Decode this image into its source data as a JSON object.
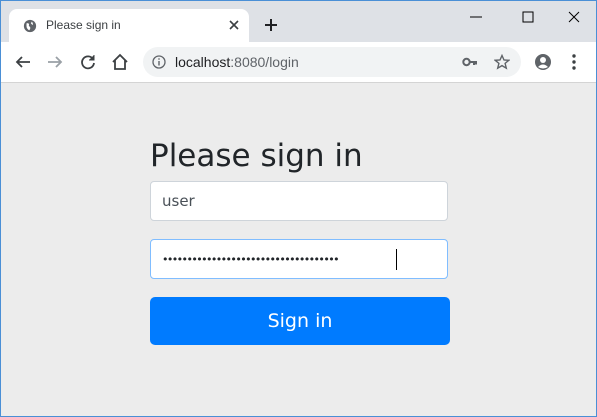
{
  "tab": {
    "title": "Please sign in"
  },
  "toolbar": {
    "url_host": "localhost",
    "url_rest": ":8080/login"
  },
  "form": {
    "heading": "Please sign in",
    "username_value": "user",
    "password_value": "••••••••••••••••••••••••••••••••••••",
    "submit_label": "Sign in"
  },
  "colors": {
    "primary_button": "#007bff",
    "page_background": "#ececec",
    "tab_strip": "#dee1e6"
  },
  "icons": {
    "favicon": "globe-icon",
    "tab_close": "close-icon",
    "new_tab": "plus-icon",
    "back": "arrow-left-icon",
    "forward": "arrow-right-icon",
    "reload": "reload-icon",
    "home": "home-icon",
    "site_info": "info-icon",
    "passwords": "key-icon",
    "bookmark": "star-icon",
    "profile": "profile-icon",
    "menu": "more-vert-icon"
  }
}
